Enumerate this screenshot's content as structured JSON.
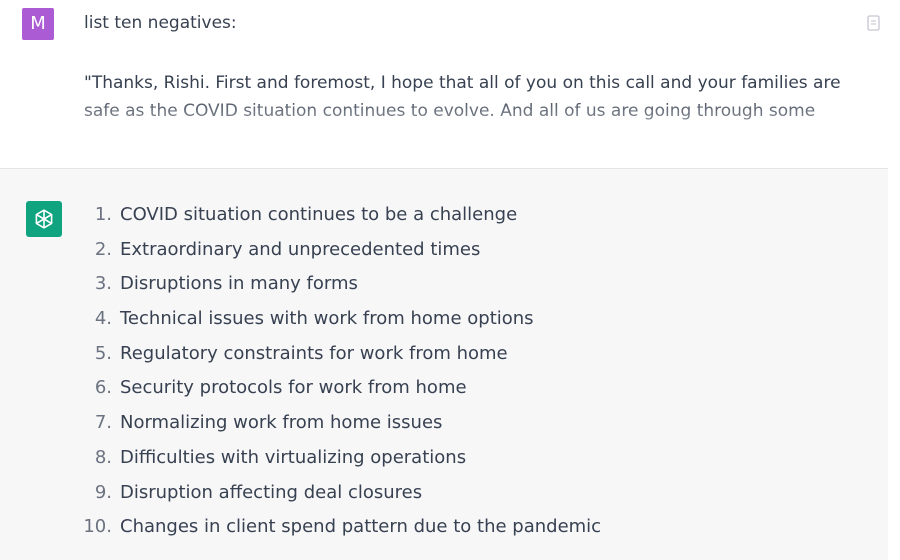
{
  "user": {
    "avatar_letter": "M",
    "prompt_title": "list ten negatives:",
    "prompt_body": "\"Thanks, Rishi. First and foremost, I hope that all of you on this call and your families are safe as the COVID situation continues to evolve. And all of us are going through some"
  },
  "assistant": {
    "items": [
      {
        "num": "1.",
        "text": "COVID situation continues to be a challenge"
      },
      {
        "num": "2.",
        "text": "Extraordinary and unprecedented times"
      },
      {
        "num": "3.",
        "text": "Disruptions in many forms"
      },
      {
        "num": "4.",
        "text": "Technical issues with work from home options"
      },
      {
        "num": "5.",
        "text": "Regulatory constraints for work from home"
      },
      {
        "num": "6.",
        "text": "Security protocols for work from home"
      },
      {
        "num": "7.",
        "text": "Normalizing work from home issues"
      },
      {
        "num": "8.",
        "text": "Difficulties with virtualizing operations"
      },
      {
        "num": "9.",
        "text": "Disruption affecting deal closures"
      },
      {
        "num": "10.",
        "text": "Changes in client spend pattern due to the pandemic"
      }
    ]
  },
  "icons": {
    "user_avatar": "avatar",
    "assistant_logo": "openai-logo-icon",
    "edit": "edit-icon"
  },
  "colors": {
    "user_avatar_bg": "#ab5bd4",
    "assistant_logo_bg": "#10a37f",
    "assistant_bg": "#f7f7f8",
    "text": "#374151"
  }
}
